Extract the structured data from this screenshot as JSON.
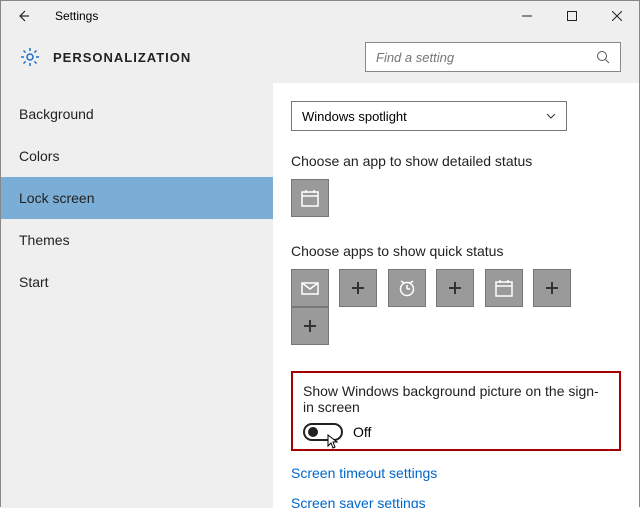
{
  "titlebar": {
    "app_title": "Settings"
  },
  "header": {
    "page_title": "PERSONALIZATION",
    "search_placeholder": "Find a setting"
  },
  "sidebar": {
    "items": [
      {
        "label": "Background",
        "selected": false
      },
      {
        "label": "Colors",
        "selected": false
      },
      {
        "label": "Lock screen",
        "selected": true
      },
      {
        "label": "Themes",
        "selected": false
      },
      {
        "label": "Start",
        "selected": false
      }
    ]
  },
  "main": {
    "background_dropdown": {
      "value": "Windows spotlight"
    },
    "detailed_status_label": "Choose an app to show detailed status",
    "detailed_status_apps": [
      {
        "icon": "calendar"
      }
    ],
    "quick_status_label": "Choose apps to show quick status",
    "quick_status_apps": [
      {
        "icon": "mail"
      },
      {
        "icon": "plus"
      },
      {
        "icon": "alarm"
      },
      {
        "icon": "plus"
      },
      {
        "icon": "calendar"
      },
      {
        "icon": "plus"
      },
      {
        "icon": "plus"
      }
    ],
    "signin_picture": {
      "label": "Show Windows background picture on the sign-in screen",
      "state": "Off",
      "value": false
    },
    "links": {
      "screen_timeout": "Screen timeout settings",
      "screen_saver": "Screen saver settings"
    }
  }
}
